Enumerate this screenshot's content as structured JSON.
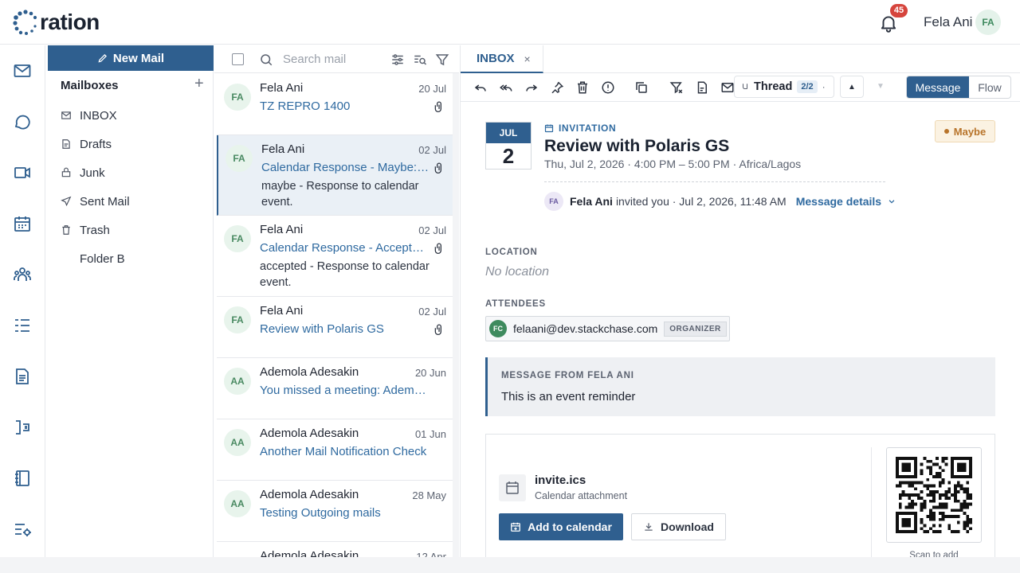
{
  "app": {
    "logo_text": "ration",
    "brand_color": "#2f5f8f"
  },
  "header": {
    "notification_count": "45",
    "user_name": "Fela Ani",
    "user_initials": "FA"
  },
  "rail": [
    "mail-icon",
    "chat-icon",
    "video-icon",
    "calendar-icon",
    "contacts-icon",
    "tasks-icon",
    "document-icon",
    "reader-icon",
    "notebook-icon",
    "settings-icon"
  ],
  "mailboxes": {
    "new_mail_label": "New Mail",
    "title": "Mailboxes",
    "add_label": "+",
    "items": [
      {
        "label": "INBOX",
        "icon": "inbox-icon"
      },
      {
        "label": "Drafts",
        "icon": "drafts-icon"
      },
      {
        "label": "Junk",
        "icon": "junk-icon"
      },
      {
        "label": "Sent Mail",
        "icon": "sent-icon"
      },
      {
        "label": "Trash",
        "icon": "trash-icon"
      },
      {
        "label": "Folder B",
        "icon": ""
      }
    ]
  },
  "list": {
    "search_placeholder": "Search mail",
    "mails": [
      {
        "initials": "FA",
        "from": "Fela Ani",
        "date": "20 Jul",
        "subject": "TZ REPRO 1400",
        "preview": "",
        "attachment": true,
        "selected": false
      },
      {
        "initials": "FA",
        "from": "Fela Ani",
        "date": "02 Jul",
        "subject": "Calendar Response - Maybe: Review with Polaris GS",
        "preview": "maybe - Response to calendar event.",
        "attachment": true,
        "selected": true
      },
      {
        "initials": "FA",
        "from": "Fela Ani",
        "date": "02 Jul",
        "subject": "Calendar Response - Accepted: Review with Polaris GS",
        "preview": "accepted - Response to calendar event.",
        "attachment": true,
        "selected": false
      },
      {
        "initials": "FA",
        "from": "Fela Ani",
        "date": "02 Jul",
        "subject": "Review with Polaris GS",
        "preview": "",
        "attachment": true,
        "selected": false
      },
      {
        "initials": "AA",
        "from": "Ademola Adesakin",
        "date": "20 Jun",
        "subject": "You missed a meeting: Ademola's meeting",
        "preview": "",
        "attachment": false,
        "selected": false
      },
      {
        "initials": "AA",
        "from": "Ademola Adesakin",
        "date": "01 Jun",
        "subject": "Another Mail Notification Check",
        "preview": "",
        "attachment": false,
        "selected": false
      },
      {
        "initials": "AA",
        "from": "Ademola Adesakin",
        "date": "28 May",
        "subject": "Testing Outgoing mails",
        "preview": "",
        "attachment": false,
        "selected": false
      },
      {
        "initials": "AA",
        "from": "Ademola Adesakin",
        "date": "12 Apr",
        "subject": "",
        "preview": "",
        "attachment": false,
        "selected": false
      }
    ]
  },
  "pane": {
    "tab_label": "INBOX",
    "tab_close": "×",
    "thread_label": "Thread",
    "thread_count": "2/2",
    "view_message": "Message",
    "view_flow": "Flow",
    "event": {
      "month": "JUL",
      "day": "2",
      "tag": "INVITATION",
      "title": "Review with Polaris GS",
      "when": "Thu, Jul 2, 2026 · 4:00 PM – 5:00 PM · Africa/Lagos",
      "status": "Maybe",
      "inviter_initials": "FA",
      "inviter_name": "Fela Ani",
      "invited_text": "invited you · Jul 2, 2026, 11:48 AM",
      "details_link": "Message details"
    },
    "location_label": "LOCATION",
    "location_value": "No location",
    "attendees_label": "ATTENDEES",
    "attendee": {
      "initials": "FC",
      "email": "felaani@dev.stackchase.com",
      "role": "ORGANIZER"
    },
    "message_label": "MESSAGE FROM FELA ANI",
    "message_text": "This is an event reminder",
    "attachment": {
      "name": "invite.ics",
      "type": "Calendar attachment",
      "add_label": "Add to calendar",
      "download_label": "Download",
      "qr_caption": "Scan to add"
    }
  }
}
